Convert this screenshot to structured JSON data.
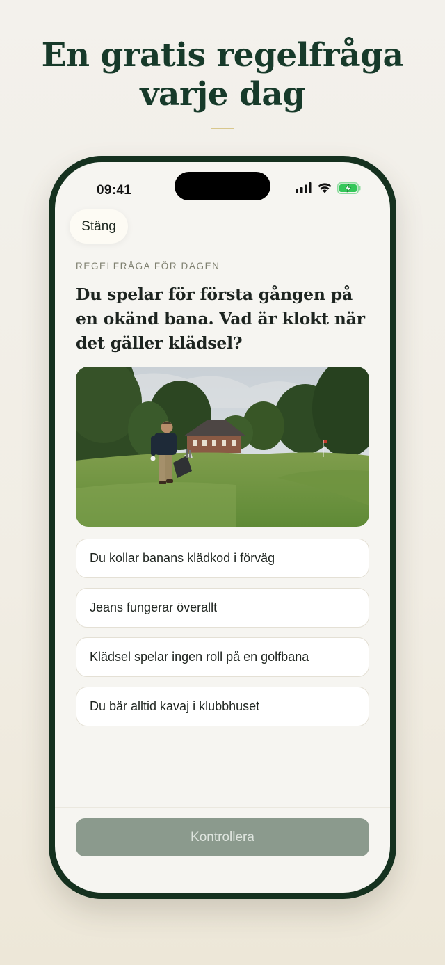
{
  "headline": {
    "line1": "En gratis regelfråga",
    "line2": "varje dag"
  },
  "status_bar": {
    "time": "09:41",
    "icons": [
      "cellular-signal-icon",
      "wifi-icon",
      "battery-charging-icon"
    ]
  },
  "header": {
    "close_label": "Stäng"
  },
  "quiz": {
    "eyebrow": "REGELFRÅGA FÖR DAGEN",
    "question": "Du spelar för första gången på en okänd bana. Vad är klokt när det gäller klädsel?",
    "options": [
      {
        "label": "Du kollar banans klädkod i förväg"
      },
      {
        "label": "Jeans fungerar överallt"
      },
      {
        "label": "Klädsel spelar ingen roll på en golfbana"
      },
      {
        "label": "Du bär alltid kavaj i klubbhuset"
      }
    ],
    "submit_label": "Kontrollera"
  },
  "colors": {
    "brand_green": "#15311f",
    "headline": "#173a2a",
    "accent_gold": "#d8c78d",
    "button_disabled": "#8b9a8d",
    "battery_green": "#34c759"
  }
}
